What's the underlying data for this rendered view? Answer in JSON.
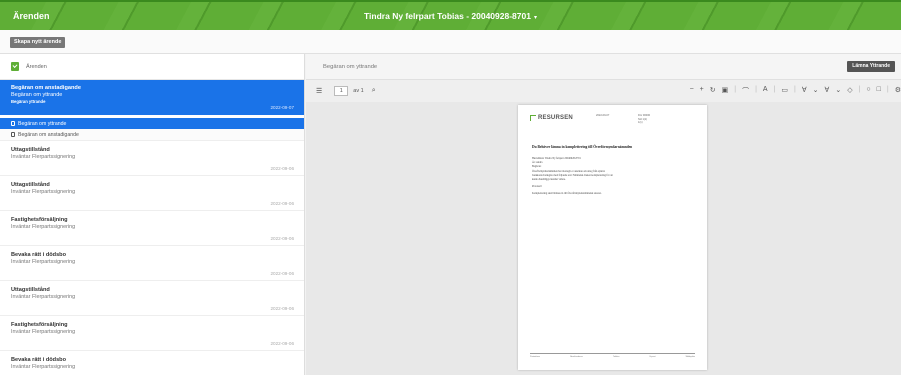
{
  "header": {
    "title": "Ärenden",
    "person": "Tindra Ny felrpart Tobias - 20040928-8701",
    "caret": "▾"
  },
  "toolbar": {
    "new_case_label": "Skapa nytt ärende"
  },
  "sidebar": {
    "header_label": "Ärenden",
    "selected": {
      "title": "Begäran om anstadigande",
      "subtitle": "Begäran om yttrande",
      "status": "Begäran yttrande",
      "date": "2022-09-07"
    },
    "sub_items": [
      {
        "label": "Begäran om yttrande",
        "active": true
      },
      {
        "label": "Begäran om anstadigande",
        "active": false
      }
    ],
    "cases": [
      {
        "title": "Uttagstillstånd",
        "subtitle": "Inväntar Flerpartssignering",
        "date": "2022-09-06"
      },
      {
        "title": "Uttagstillstånd",
        "subtitle": "Inväntar Flerpartssignering",
        "date": "2022-09-06"
      },
      {
        "title": "Fastighetsförsäljning",
        "subtitle": "Inväntar Flerpartssignering",
        "date": "2022-09-06"
      },
      {
        "title": "Bevaka rätt i dödsbo",
        "subtitle": "Inväntar Flerpartssignering",
        "date": "2022-09-06"
      },
      {
        "title": "Uttagstillstånd",
        "subtitle": "Inväntar Flerpartssignering",
        "date": "2022-09-06"
      },
      {
        "title": "Fastighetsförsäljning",
        "subtitle": "Inväntar Flerpartssignering",
        "date": "2022-09-06"
      },
      {
        "title": "Bevaka rätt i dödsbo",
        "subtitle": "Inväntar Flerpartssignering",
        "date": "2022-09-06"
      }
    ]
  },
  "viewer": {
    "title": "Begäran om yttrande",
    "submit_label": "Lämna Yttrande",
    "page_number": "1",
    "page_of": "av 1",
    "document": {
      "logo": "RESURSEN",
      "meta_left": [
        "2022-09-07"
      ],
      "meta_right": [
        "Dnr 00000",
        "Sid 1(1)",
        "1(1)"
      ],
      "heading": "Du Behöver lämna in komplettering till Överförmyndarnämnden",
      "body": [
        "Huvudman:    Tindra Ny felrpart 20040928-8701",
        "Är: Andra",
        "Begäran:",
        "Överförmyndarnämnden har mottagit er ansökan om uttag från spärrat",
        "bankkonto/bankgiro med följande text: Nämnden önskar komplettering för att",
        "kunna handlägga ärendet vidare.",
        "Protokoll",
        "Komplettering skall lämnas in till Överförmyndarnämnden snarast."
      ],
      "footer": [
        "Postadress",
        "Besöksadress",
        "Telefon",
        "E-post",
        "Webbplats"
      ]
    }
  }
}
